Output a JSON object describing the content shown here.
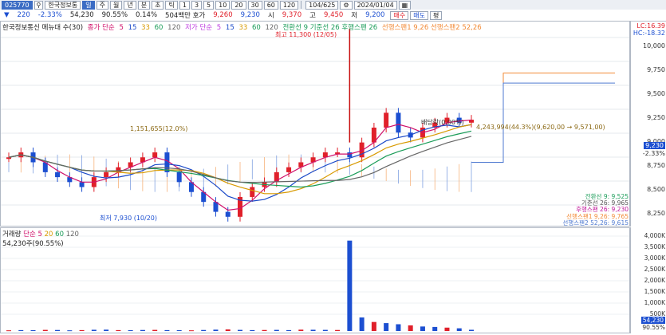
{
  "toolbar": {
    "code": "025770",
    "name": "한국정보통",
    "mode": "일",
    "periods": [
      "주",
      "월",
      "년",
      "분",
      "초",
      "틱"
    ],
    "intervals": [
      "1",
      "3",
      "5",
      "10",
      "20",
      "30",
      "60",
      "120"
    ],
    "page": "104/625",
    "date": "2024/01/04"
  },
  "status": {
    "change_pct_a": "220",
    "change": "-2.33%",
    "price": "54,230",
    "rate": "90.55%",
    "rate2": "0.14%",
    "quote": "504백만 호가",
    "bid": "9,260",
    "ask": "9,230",
    "open_label": "시",
    "open": "9,370",
    "high_label": "고",
    "high": "9,450",
    "low_label": "저",
    "low": "9,200",
    "buy": "매수",
    "sell": "매도",
    "flat": "평"
  },
  "legend": {
    "title": "한국정보통신 메뉴대 수(30)",
    "ma_label": "종가 단순",
    "ma": [
      "5",
      "15",
      "33",
      "60",
      "120"
    ],
    "low_label": "저가 단순",
    "low_ma": [
      "5",
      "15",
      "33",
      "60",
      "120"
    ],
    "ichimoku": "전환선 9  기준선 26  후행스팬 26",
    "span": "선행스팬1 9,26  선행스팬2 52,26"
  },
  "annotations": {
    "high": "최고 11,300 (12/05)",
    "low": "최저 7,930 (10/20)",
    "volume_note": "4,243,994(44.3%)(9,620,00 → 9,571,00)",
    "ratio_left": "1,151,655(12.0%)",
    "dividend": "배당락(0.00%)",
    "lc": "LC:16.39",
    "hc": "HC:-18.32"
  },
  "right_panel": {
    "price_now": "9,230",
    "change_now": "-2.33%",
    "ichimoku_values": [
      {
        "label": "전환선 9: 9,525",
        "color": "#1a9c58"
      },
      {
        "label": "기준선 26: 9,965",
        "color": "#555555"
      },
      {
        "label": "후행스팬 26: 9,230",
        "color": "#c0149a"
      },
      {
        "label": "선행스팬1 9,26: 9,765",
        "color": "#f28a36"
      },
      {
        "label": "선행스팬2 52,26: 9,615",
        "color": "#4f7ad1"
      }
    ]
  },
  "price_ticks": [
    "10,000",
    "9,750",
    "9,500",
    "9,250",
    "9,000",
    "8,750",
    "8,500",
    "8,250"
  ],
  "volume_legend": {
    "label": "거래량",
    "ma_label": "단순",
    "ma": [
      "5",
      "20",
      "60",
      "120"
    ],
    "last": "54,230주(90.55%)"
  },
  "volume_ticks": [
    "4,000K",
    "3,500K",
    "3,000K",
    "2,500K",
    "2,000K",
    "1,500K",
    "1,000K",
    "500K"
  ],
  "volume_now": "54,230",
  "volume_pct": "90.55%",
  "chart_data": {
    "type": "line",
    "series": [
      {
        "name": "종가",
        "values": [
          8850,
          8900,
          8800,
          8700,
          8650,
          8600,
          8550,
          8650,
          8700,
          8750,
          8800,
          8850,
          8900,
          8700,
          8600,
          8500,
          8400,
          8300,
          8250,
          8450,
          8550,
          8600,
          8700,
          8750,
          8800,
          8850,
          8900,
          8900,
          8850,
          9000,
          9150,
          9300,
          9100,
          9050,
          9150,
          9200,
          9250,
          9200,
          9230
        ]
      },
      {
        "name": "거래량",
        "values": [
          30,
          40,
          35,
          50,
          45,
          30,
          40,
          55,
          60,
          40,
          35,
          45,
          50,
          40,
          35,
          30,
          45,
          60,
          70,
          50,
          40,
          45,
          50,
          40,
          60,
          55,
          50,
          45,
          4000,
          600,
          400,
          350,
          300,
          250,
          200,
          180,
          150,
          120,
          54
        ]
      }
    ],
    "ylim": [
      8200,
      10100
    ],
    "ylabel": "",
    "xlabel": ""
  }
}
